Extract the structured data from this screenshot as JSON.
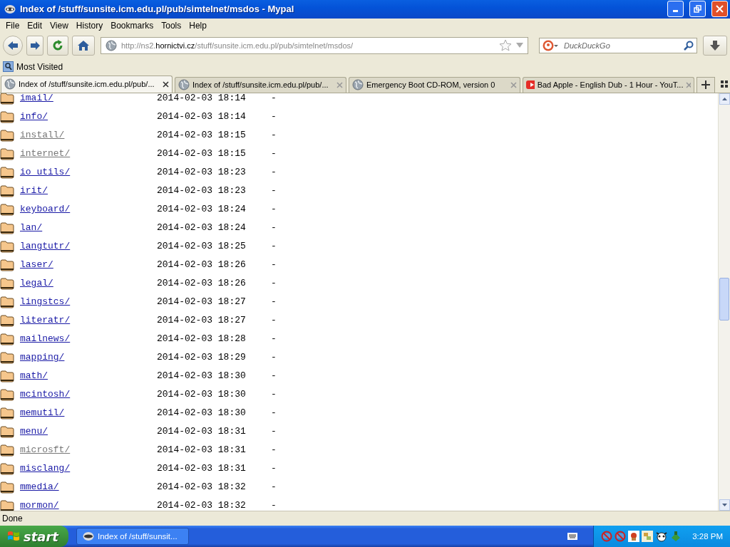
{
  "window": {
    "title": "Index of /stuff/sunsite.icm.edu.pl/pub/simtelnet/msdos - Mypal"
  },
  "menu": [
    "File",
    "Edit",
    "View",
    "History",
    "Bookmarks",
    "Tools",
    "Help"
  ],
  "address": {
    "prefix": "http://ns2.",
    "domain": "hornictvi.cz",
    "path": "/stuff/sunsite.icm.edu.pl/pub/simtelnet/msdos/"
  },
  "search": {
    "placeholder": "DuckDuckGo"
  },
  "bookmarks": [
    "Most Visited"
  ],
  "tabs": [
    {
      "label": "Index of /stuff/sunsite.icm.edu.pl/pub/...",
      "selected": true,
      "kind": "globe"
    },
    {
      "label": "Index of /stuff/sunsite.icm.edu.pl/pub/...",
      "selected": false,
      "kind": "globe"
    },
    {
      "label": "Emergency Boot CD-ROM, version 0",
      "selected": false,
      "kind": "globe"
    },
    {
      "label": "Bad Apple - English Dub - 1 Hour - YouT...",
      "selected": false,
      "kind": "video"
    }
  ],
  "listing": [
    {
      "name": "imail/",
      "date": "2014-02-03 18:14",
      "size": "-",
      "visited": false
    },
    {
      "name": "info/",
      "date": "2014-02-03 18:14",
      "size": "-",
      "visited": false
    },
    {
      "name": "install/",
      "date": "2014-02-03 18:15",
      "size": "-",
      "visited": true
    },
    {
      "name": "internet/",
      "date": "2014-02-03 18:15",
      "size": "-",
      "visited": true
    },
    {
      "name": "io_utils/",
      "date": "2014-02-03 18:23",
      "size": "-",
      "visited": false
    },
    {
      "name": "irit/",
      "date": "2014-02-03 18:23",
      "size": "-",
      "visited": false
    },
    {
      "name": "keyboard/",
      "date": "2014-02-03 18:24",
      "size": "-",
      "visited": false
    },
    {
      "name": "lan/",
      "date": "2014-02-03 18:24",
      "size": "-",
      "visited": false
    },
    {
      "name": "langtutr/",
      "date": "2014-02-03 18:25",
      "size": "-",
      "visited": false
    },
    {
      "name": "laser/",
      "date": "2014-02-03 18:26",
      "size": "-",
      "visited": false
    },
    {
      "name": "legal/",
      "date": "2014-02-03 18:26",
      "size": "-",
      "visited": false
    },
    {
      "name": "lingstcs/",
      "date": "2014-02-03 18:27",
      "size": "-",
      "visited": false
    },
    {
      "name": "literatr/",
      "date": "2014-02-03 18:27",
      "size": "-",
      "visited": false
    },
    {
      "name": "mailnews/",
      "date": "2014-02-03 18:28",
      "size": "-",
      "visited": false
    },
    {
      "name": "mapping/",
      "date": "2014-02-03 18:29",
      "size": "-",
      "visited": false
    },
    {
      "name": "math/",
      "date": "2014-02-03 18:30",
      "size": "-",
      "visited": false
    },
    {
      "name": "mcintosh/",
      "date": "2014-02-03 18:30",
      "size": "-",
      "visited": false
    },
    {
      "name": "memutil/",
      "date": "2014-02-03 18:30",
      "size": "-",
      "visited": false
    },
    {
      "name": "menu/",
      "date": "2014-02-03 18:31",
      "size": "-",
      "visited": false
    },
    {
      "name": "microsft/",
      "date": "2014-02-03 18:31",
      "size": "-",
      "visited": true
    },
    {
      "name": "misclang/",
      "date": "2014-02-03 18:31",
      "size": "-",
      "visited": false
    },
    {
      "name": "mmedia/",
      "date": "2014-02-03 18:32",
      "size": "-",
      "visited": false
    },
    {
      "name": "mormon/",
      "date": "2014-02-03 18:32",
      "size": "-",
      "visited": false
    }
  ],
  "status_bar": {
    "text": "Done"
  },
  "taskbar": {
    "start": "start",
    "windows": [
      {
        "label": "Index of /stuff/sunsit...",
        "selected": false
      }
    ],
    "clock": "3:28 PM"
  }
}
